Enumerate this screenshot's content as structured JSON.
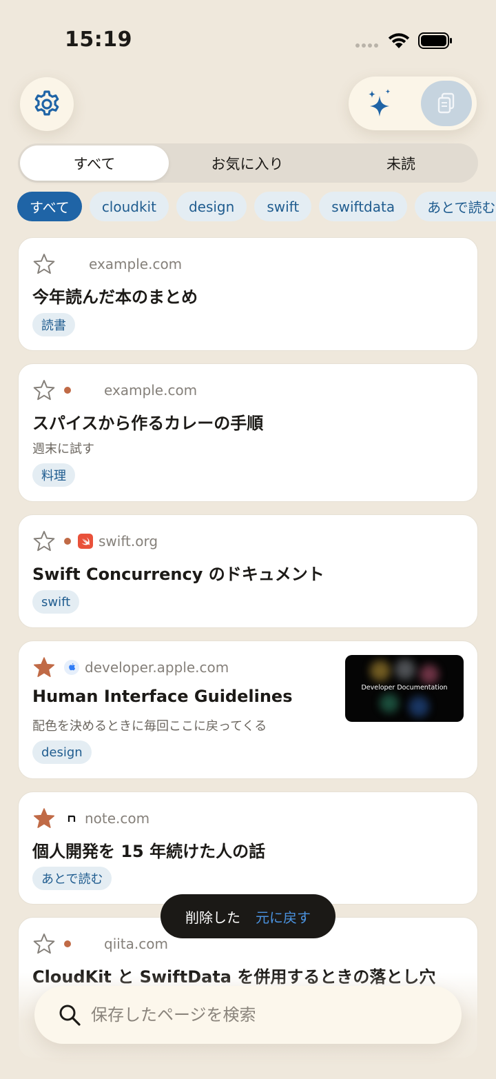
{
  "status": {
    "time": "15:19"
  },
  "segments": [
    {
      "label": "すべて"
    },
    {
      "label": "お気に入り"
    },
    {
      "label": "未読"
    }
  ],
  "chips": [
    {
      "label": "すべて"
    },
    {
      "label": "cloudkit"
    },
    {
      "label": "design"
    },
    {
      "label": "swift"
    },
    {
      "label": "swiftdata"
    },
    {
      "label": "あとで読む"
    }
  ],
  "cards": [
    {
      "domain": "example.com",
      "title": "今年読んだ本のまとめ",
      "note": "",
      "tag": "読書",
      "favorite": false,
      "unread": false
    },
    {
      "domain": "example.com",
      "title": "スパイスから作るカレーの手順",
      "note": "週末に試す",
      "tag": "料理",
      "favorite": false,
      "unread": true
    },
    {
      "domain": "swift.org",
      "title": "Swift Concurrency のドキュメント",
      "note": "",
      "tag": "swift",
      "favorite": false,
      "unread": true
    },
    {
      "domain": "developer.apple.com",
      "title": "Human Interface Guidelines",
      "note": "配色を決めるときに毎回ここに戻ってくる",
      "tag": "design",
      "favorite": true,
      "unread": false,
      "thumbnail_text": "Developer Documentation"
    },
    {
      "domain": "note.com",
      "title": "個人開発を 15 年続けた人の話",
      "note": "",
      "tag": "あとで読む",
      "favorite": true,
      "unread": false
    },
    {
      "domain": "qiita.com",
      "title": "CloudKit と SwiftData を併用するときの落とし穴",
      "note": "",
      "tag": "",
      "favorite": false,
      "unread": true
    }
  ],
  "toast": {
    "message": "削除した",
    "action": "元に戻す"
  },
  "search": {
    "placeholder": "保存したページを検索",
    "value": ""
  },
  "colors": {
    "accent": "#1f64a6",
    "background": "#efe8dc",
    "favorite": "#c06a46",
    "unread_dot": "#c06a46"
  }
}
